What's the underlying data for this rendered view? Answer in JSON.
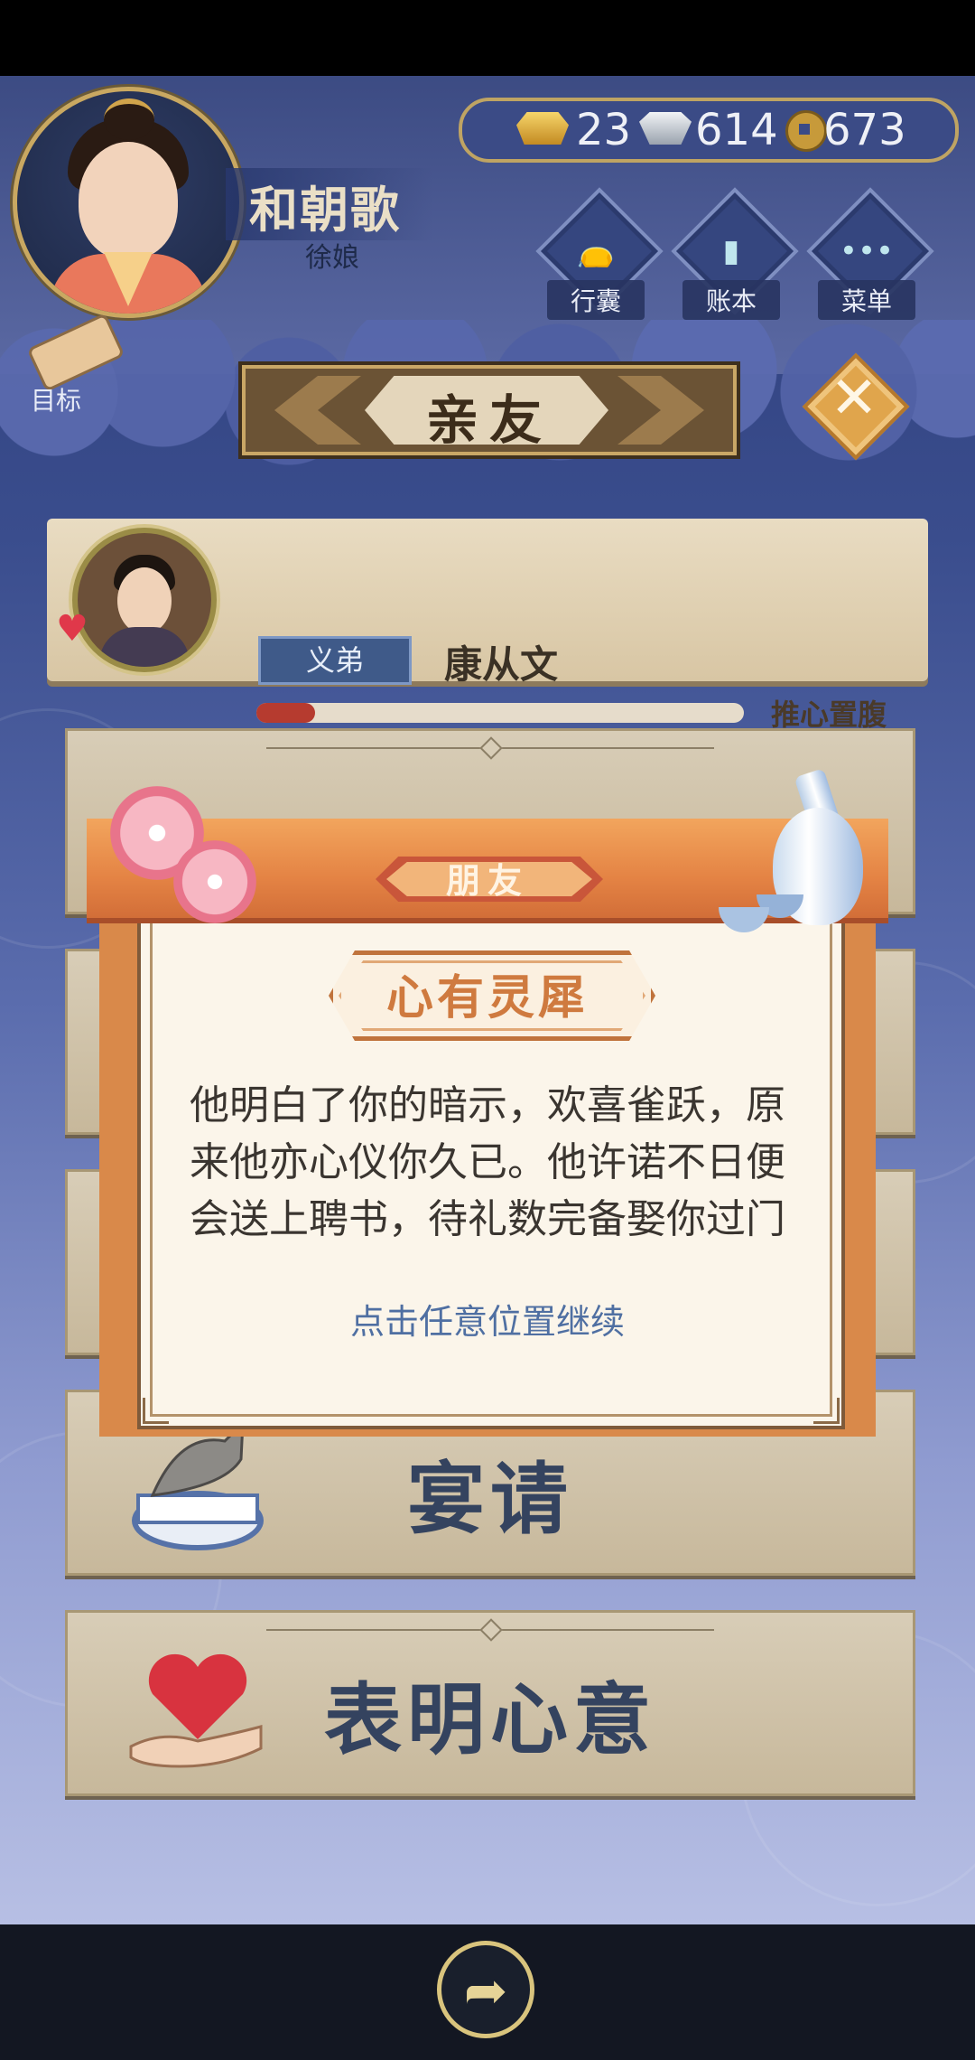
{
  "player": {
    "name": "和朝歌",
    "title": "徐娘"
  },
  "goal": {
    "label": "目标"
  },
  "currency": {
    "gold": "23",
    "silver": "614",
    "copper": "673"
  },
  "top_menu": {
    "bag": "行囊",
    "ledger": "账本",
    "menu": "菜单"
  },
  "screen_title": "亲友",
  "friend": {
    "relation": "义弟",
    "name": "康从文",
    "affinity_label": "推心置腹",
    "affinity_fraction": 0.12
  },
  "dialog": {
    "category": "朋友",
    "event_title": "心有灵犀",
    "event_text": "他明白了你的暗示，欢喜雀跃，原来他亦心仪你久已。他许诺不日便会送上聘书，待礼数完备娶你过门",
    "continue_hint": "点击任意位置继续"
  },
  "options": [
    {
      "label": "宴请"
    },
    {
      "label": "表明心意"
    }
  ],
  "colors": {
    "accent_orange": "#e48344",
    "event_title": "#cf7a3f",
    "hint_blue": "#4f6fa2",
    "affinity_red": "#b63b2f"
  },
  "icons": {
    "close": "close-icon",
    "share": "share-icon",
    "gold": "gold-ingot-icon",
    "silver": "silver-ingot-icon",
    "copper": "copper-coin-icon"
  }
}
